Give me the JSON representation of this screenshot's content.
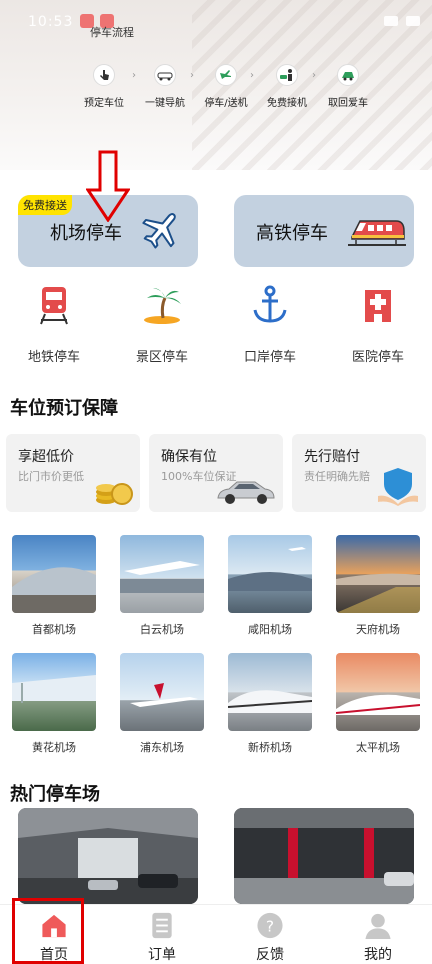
{
  "status": {
    "time": "10:53"
  },
  "flow": {
    "title": "停车流程",
    "steps": [
      {
        "label": "预定车位",
        "icon": "hand-tap-icon"
      },
      {
        "label": "一键导航",
        "icon": "car-navigation-icon"
      },
      {
        "label": "停车/送机",
        "icon": "plane-car-icon"
      },
      {
        "label": "免费接机",
        "icon": "person-car-icon"
      },
      {
        "label": "取回爱车",
        "icon": "car-return-icon"
      }
    ]
  },
  "transport": {
    "airport": {
      "label": "机场停车",
      "badge": "免费接送"
    },
    "rail": {
      "label": "高铁停车"
    }
  },
  "categories": [
    {
      "label": "地铁停车",
      "icon": "subway-icon",
      "color": "#e34b4b"
    },
    {
      "label": "景区停车",
      "icon": "palm-island-icon",
      "color": "#2e9e5b"
    },
    {
      "label": "口岸停车",
      "icon": "anchor-icon",
      "color": "#2d6ec9"
    },
    {
      "label": "医院停车",
      "icon": "hospital-icon",
      "color": "#e34b4b"
    }
  ],
  "guarantee": {
    "title": "车位预订保障",
    "items": [
      {
        "title": "享超低价",
        "sub": "比门市价更低"
      },
      {
        "title": "确保有位",
        "sub": "100%车位保证"
      },
      {
        "title": "先行赔付",
        "sub": "责任明确先赔"
      }
    ]
  },
  "airports_row1": [
    {
      "label": "首都机场"
    },
    {
      "label": "白云机场"
    },
    {
      "label": "咸阳机场"
    },
    {
      "label": "天府机场"
    }
  ],
  "airports_row2": [
    {
      "label": "黄花机场"
    },
    {
      "label": "浦东机场"
    },
    {
      "label": "新桥机场"
    },
    {
      "label": "太平机场"
    }
  ],
  "hot_parking": {
    "title": "热门停车场"
  },
  "tabs": [
    {
      "label": "首页",
      "icon": "home-icon"
    },
    {
      "label": "订单",
      "icon": "order-list-icon"
    },
    {
      "label": "反馈",
      "icon": "feedback-question-icon"
    },
    {
      "label": "我的",
      "icon": "profile-icon"
    }
  ],
  "colors": {
    "card_bg": "#c3d1e0",
    "badge": "#ffe300",
    "highlight": "#e00000"
  }
}
